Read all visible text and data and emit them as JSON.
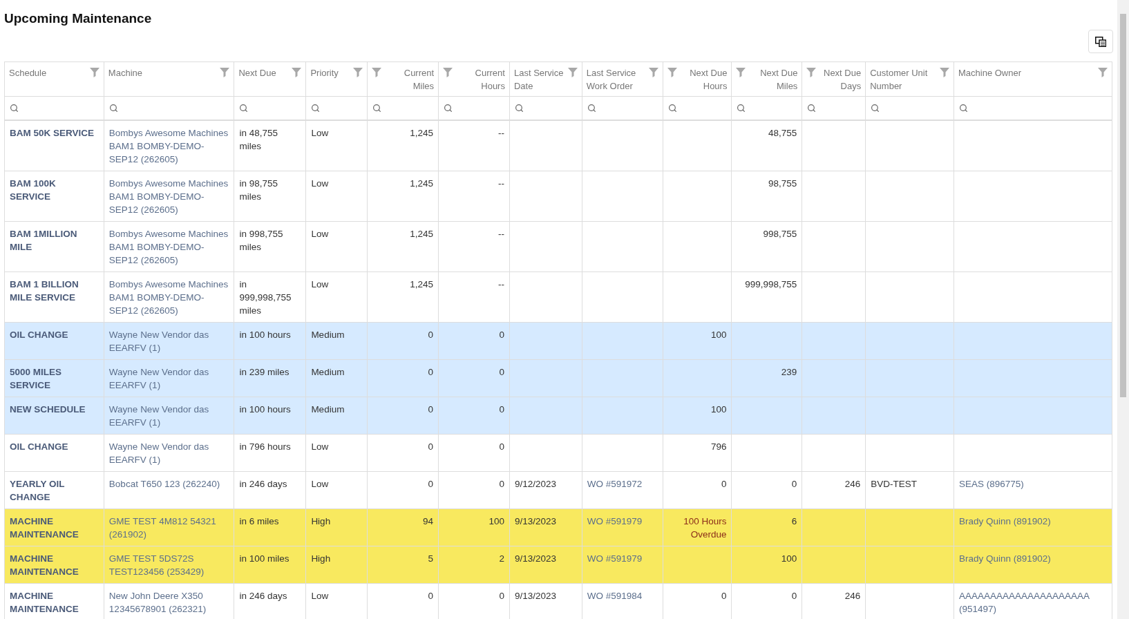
{
  "title": "Upcoming Maintenance",
  "table": {
    "columns": [
      {
        "label": "Schedule",
        "numeric": false,
        "kind": "bold"
      },
      {
        "label": "Machine",
        "numeric": false,
        "kind": "link"
      },
      {
        "label": "Next Due",
        "numeric": false,
        "kind": "text"
      },
      {
        "label": "Priority",
        "numeric": false,
        "kind": "text"
      },
      {
        "label": "Current Miles",
        "numeric": true,
        "kind": "text"
      },
      {
        "label": "Current Hours",
        "numeric": true,
        "kind": "text"
      },
      {
        "label": "Last Service Date",
        "numeric": false,
        "kind": "text"
      },
      {
        "label": "Last Service Work Order",
        "numeric": false,
        "kind": "link"
      },
      {
        "label": "Next Due Hours",
        "numeric": true,
        "kind": "text"
      },
      {
        "label": "Next Due Miles",
        "numeric": true,
        "kind": "text"
      },
      {
        "label": "Next Due Days",
        "numeric": true,
        "kind": "text"
      },
      {
        "label": "Customer Unit Number",
        "numeric": false,
        "kind": "text"
      },
      {
        "label": "Machine Owner",
        "numeric": false,
        "kind": "link"
      }
    ],
    "rows": [
      {
        "color": "#ffffff",
        "cells": [
          "BAM 50K SERVICE",
          "Bombys Awesome Machines BAM1 BOMBY-DEMO-SEP12 (262605)",
          "in 48,755 miles",
          "Low",
          "1,245",
          "--",
          "",
          "",
          "",
          "48,755",
          "",
          "",
          ""
        ]
      },
      {
        "color": "#ffffff",
        "cells": [
          "BAM 100K SERVICE",
          "Bombys Awesome Machines BAM1 BOMBY-DEMO-SEP12 (262605)",
          "in 98,755 miles",
          "Low",
          "1,245",
          "--",
          "",
          "",
          "",
          "98,755",
          "",
          "",
          ""
        ]
      },
      {
        "color": "#ffffff",
        "cells": [
          "BAM 1MILLION MILE",
          "Bombys Awesome Machines BAM1 BOMBY-DEMO-SEP12 (262605)",
          "in 998,755 miles",
          "Low",
          "1,245",
          "--",
          "",
          "",
          "",
          "998,755",
          "",
          "",
          ""
        ]
      },
      {
        "color": "#ffffff",
        "cells": [
          "BAM 1 BILLION MILE SERVICE",
          "Bombys Awesome Machines BAM1 BOMBY-DEMO-SEP12 (262605)",
          "in 999,998,755 miles",
          "Low",
          "1,245",
          "--",
          "",
          "",
          "",
          "999,998,755",
          "",
          "",
          ""
        ]
      },
      {
        "color": "#d6eaff",
        "cells": [
          "OIL CHANGE",
          "Wayne New Vendor das EEARFV (1)",
          "in 100 hours",
          "Medium",
          "0",
          "0",
          "",
          "",
          "100",
          "",
          "",
          "",
          ""
        ]
      },
      {
        "color": "#d6eaff",
        "cells": [
          "5000 MILES SERVICE",
          "Wayne New Vendor das EEARFV (1)",
          "in 239 miles",
          "Medium",
          "0",
          "0",
          "",
          "",
          "",
          "239",
          "",
          "",
          ""
        ]
      },
      {
        "color": "#d6eaff",
        "cells": [
          "NEW SCHEDULE",
          "Wayne New Vendor das EEARFV (1)",
          "in 100 hours",
          "Medium",
          "0",
          "0",
          "",
          "",
          "100",
          "",
          "",
          "",
          ""
        ]
      },
      {
        "color": "#ffffff",
        "cells": [
          "OIL CHANGE",
          "Wayne New Vendor das EEARFV (1)",
          "in 796 hours",
          "Low",
          "0",
          "0",
          "",
          "",
          "796",
          "",
          "",
          "",
          ""
        ]
      },
      {
        "color": "#ffffff",
        "cells": [
          "YEARLY OIL CHANGE",
          "Bobcat T650 123 (262240)",
          "in 246 days",
          "Low",
          "0",
          "0",
          "9/12/2023",
          "WO #591972",
          "0",
          "0",
          "246",
          "BVD-TEST",
          "SEAS (896775)"
        ]
      },
      {
        "color": "#f8e95f",
        "cells": [
          "MACHINE MAINTENANCE",
          "GME TEST 4M812 54321 (261902)",
          "in 6 miles",
          "High",
          "94",
          "100",
          "9/13/2023",
          "WO #591979",
          {
            "text": "100 Hours Overdue",
            "kind": "overdue"
          },
          "6",
          "",
          "",
          "Brady Quinn (891902)"
        ]
      },
      {
        "color": "#f8e95f",
        "cells": [
          "MACHINE MAINTENANCE",
          "GME TEST 5DS72S TEST123456 (253429)",
          "in 100 miles",
          "High",
          "5",
          "2",
          "9/13/2023",
          "WO #591979",
          "",
          "100",
          "",
          "",
          "Brady Quinn (891902)"
        ]
      },
      {
        "color": "#ffffff",
        "cells": [
          "MACHINE MAINTENANCE",
          "New John Deere X350 12345678901 (262321)",
          "in 246 days",
          "Low",
          "0",
          "0",
          "9/13/2023",
          "WO #591984",
          "0",
          "0",
          "246",
          "",
          "AAAAAAAAAAAAAAAAAAAAA (951497)"
        ]
      }
    ]
  }
}
